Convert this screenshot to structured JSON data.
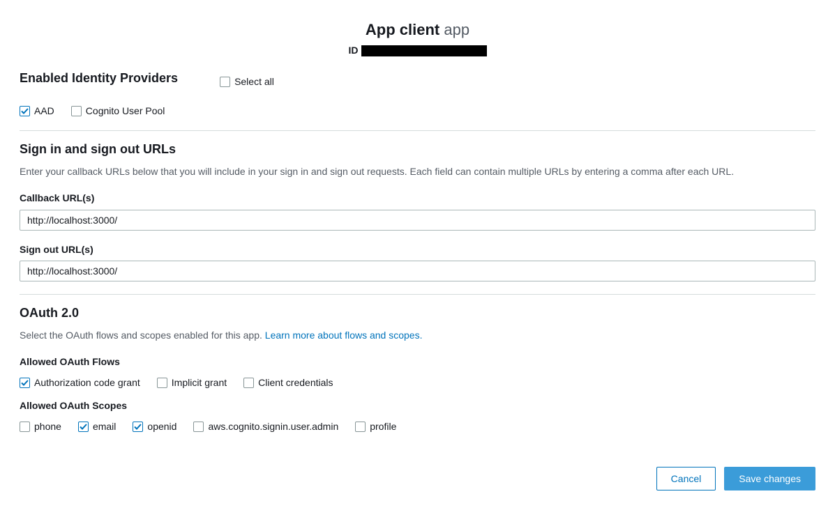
{
  "header": {
    "title_bold": "App client",
    "title_light": "app",
    "id_label": "ID"
  },
  "idp": {
    "heading": "Enabled Identity Providers",
    "select_all": "Select all",
    "options": [
      {
        "key": "aad",
        "label": "AAD",
        "checked": true
      },
      {
        "key": "cognito",
        "label": "Cognito User Pool",
        "checked": false
      }
    ]
  },
  "urls": {
    "heading": "Sign in and sign out URLs",
    "desc": "Enter your callback URLs below that you will include in your sign in and sign out requests. Each field can contain multiple URLs by entering a comma after each URL.",
    "callback_label": "Callback URL(s)",
    "callback_value": "http://localhost:3000/",
    "signout_label": "Sign out URL(s)",
    "signout_value": "http://localhost:3000/"
  },
  "oauth": {
    "heading": "OAuth 2.0",
    "desc": "Select the OAuth flows and scopes enabled for this app. ",
    "learn_more": "Learn more about flows and scopes.",
    "flows_label": "Allowed OAuth Flows",
    "flows": [
      {
        "key": "auth-code",
        "label": "Authorization code grant",
        "checked": true
      },
      {
        "key": "implicit",
        "label": "Implicit grant",
        "checked": false
      },
      {
        "key": "client-creds",
        "label": "Client credentials",
        "checked": false
      }
    ],
    "scopes_label": "Allowed OAuth Scopes",
    "scopes": [
      {
        "key": "phone",
        "label": "phone",
        "checked": false
      },
      {
        "key": "email",
        "label": "email",
        "checked": true
      },
      {
        "key": "openid",
        "label": "openid",
        "checked": true
      },
      {
        "key": "aws-cognito-admin",
        "label": "aws.cognito.signin.user.admin",
        "checked": false
      },
      {
        "key": "profile",
        "label": "profile",
        "checked": false
      }
    ]
  },
  "footer": {
    "cancel": "Cancel",
    "save": "Save changes"
  }
}
